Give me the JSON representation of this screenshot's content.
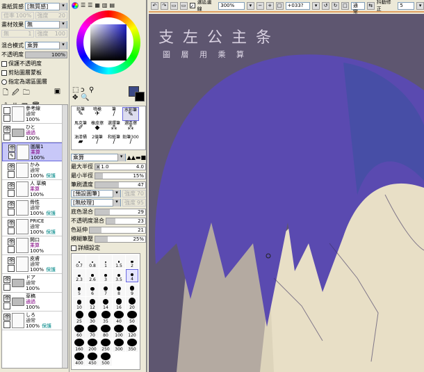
{
  "left": {
    "paper_texture_label": "畫紙質感",
    "paper_texture_value": "[無質感]",
    "scale_label": "倍率",
    "scale_value": "100%",
    "strength_label": "強度",
    "strength_value": "20",
    "paper_effect_label": "畫材效果",
    "paper_effect_value": "無",
    "effect_label": "無",
    "effect_value": "1",
    "effect_strength_label": "強度",
    "effect_strength_value": "100",
    "blend_label": "混合模式",
    "blend_value": "乘算",
    "opacity_label": "不透明度",
    "opacity_value": "100%",
    "opacity": 100,
    "check_preserve": "保護不透明度",
    "check_clip": "剪貼圖層蒙板",
    "check_select": "指定為選區圖層",
    "layers": [
      {
        "name": "參考線",
        "mode": "通常",
        "opacity": "100%",
        "protect": "",
        "kind": "layer",
        "indent": false,
        "purple": false
      },
      {
        "name": "ひと",
        "mode": "通過",
        "opacity": "100%",
        "protect": "",
        "kind": "folder",
        "indent": false,
        "purple": true
      },
      {
        "name": "圖層1",
        "mode": "乘算",
        "opacity": "100%",
        "protect": "",
        "kind": "layer",
        "indent": true,
        "purple": true,
        "active": true
      },
      {
        "name": "かみ",
        "mode": "通常",
        "opacity": "100%",
        "protect": "保護",
        "kind": "layer",
        "indent": true,
        "purple": false
      },
      {
        "name": "人 草稿",
        "mode": "乘算",
        "opacity": "100%",
        "protect": "",
        "kind": "layer",
        "indent": true,
        "purple": true
      },
      {
        "name": "骨性",
        "mode": "通常",
        "opacity": "100%",
        "protect": "保護",
        "kind": "layer",
        "indent": true,
        "purple": false
      },
      {
        "name": "PRICE",
        "mode": "通常",
        "opacity": "100%",
        "protect": "保護",
        "kind": "layer",
        "indent": true,
        "purple": false
      },
      {
        "name": "開口",
        "mode": "乘算",
        "opacity": "100%",
        "protect": "",
        "kind": "layer",
        "indent": true,
        "purple": true
      },
      {
        "name": "皮膚",
        "mode": "通常",
        "opacity": "100%",
        "protect": "保護",
        "kind": "layer",
        "indent": true,
        "purple": false
      },
      {
        "name": "ドア",
        "mode": "通常",
        "opacity": "100%",
        "protect": "",
        "kind": "folder",
        "indent": false,
        "purple": false
      },
      {
        "name": "草稿",
        "mode": "通過",
        "opacity": "100%",
        "protect": "",
        "kind": "folder",
        "indent": false,
        "purple": true
      },
      {
        "name": "しろ",
        "mode": "通常",
        "opacity": "100%",
        "protect": "保護",
        "kind": "layer",
        "indent": false,
        "purple": false
      }
    ]
  },
  "mid": {
    "tools": [
      {
        "name": "鉛筆",
        "icon": "✎"
      },
      {
        "name": "噴槍",
        "icon": "✈"
      },
      {
        "name": "筆",
        "icon": "/"
      },
      {
        "name": "水彩筆",
        "icon": "✎",
        "active": true
      },
      {
        "name": "馬克筆",
        "icon": "✐"
      },
      {
        "name": "橡皮擦",
        "icon": "◆"
      },
      {
        "name": "選擇筆",
        "icon": "⁂"
      },
      {
        "name": "選區擦",
        "icon": "⁂"
      },
      {
        "name": "油漆桶",
        "icon": "▰"
      },
      {
        "name": "2値筆",
        "icon": "/"
      },
      {
        "name": "和紙筆",
        "icon": "/"
      },
      {
        "name": "鉛筆300",
        "icon": "/"
      }
    ],
    "blend_mode": "乘算",
    "max_size_label": "最大半徑",
    "max_size_mult": "x 1.0",
    "max_size_value": "4.0",
    "max_size": 10,
    "min_size_label": "最小半徑",
    "min_size_value": "15%",
    "min_size": 15,
    "density_label": "筆刷濃度",
    "density_value": "47",
    "density": 47,
    "shape_value": "[預設圓筆]",
    "shape_strength_label": "強度",
    "shape_strength_value": "70",
    "texture_value": "[無紋理]",
    "texture_strength_label": "強度",
    "texture_strength_value": "95",
    "blending_label": "底色混合",
    "blending_value": "29",
    "blending": 29,
    "dilution_label": "不透明度混合",
    "dilution_value": "23",
    "dilution": 23,
    "persistence_label": "色延伸",
    "persistence_value": "21",
    "persistence": 21,
    "blur_label": "模糊筆壓",
    "blur_value": "25%",
    "blur": 25,
    "detail_label": "詳細設定",
    "sizes": [
      "0.7",
      "0.8",
      "1",
      "1.5",
      "2",
      "2.3",
      "2.6",
      "3",
      "3.5",
      "4",
      "5",
      "6",
      "7",
      "8",
      "9",
      "10",
      "12",
      "14",
      "16",
      "20",
      "25",
      "30",
      "35",
      "40",
      "50",
      "60",
      "70",
      "80",
      "100",
      "120",
      "160",
      "200",
      "250",
      "300",
      "350",
      "400",
      "450",
      "500"
    ],
    "active_size": "4",
    "main_color": "#3c4a86"
  },
  "topbar": {
    "selection_label": "選區邊線",
    "zoom": "300%",
    "angle": "+033?",
    "mode": "通常",
    "stabilizer_label": "抖動修正",
    "stabilizer": "5"
  },
  "canvas": {
    "logo_top": "支 左 公 主 条",
    "logo_sub": "圖 層 用 乘 算",
    "hair_color": "#5a4ab0",
    "bg_color": "#5e5670"
  }
}
